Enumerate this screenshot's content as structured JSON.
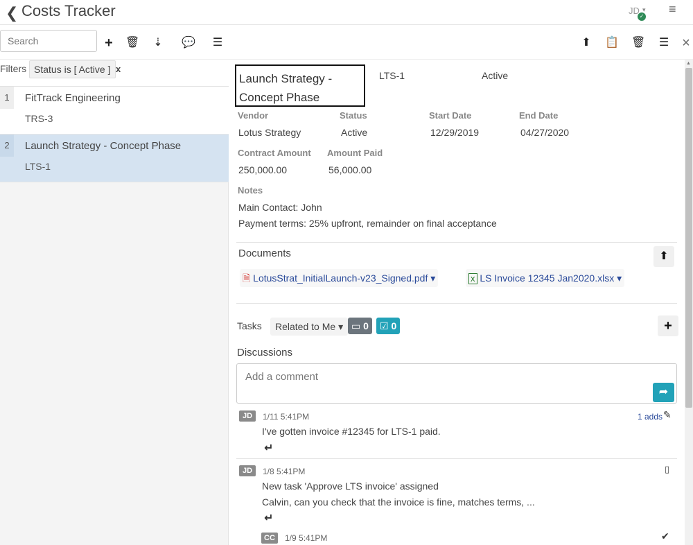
{
  "header": {
    "back_glyph": "❮",
    "title": "Costs Tracker",
    "user_initials": "JD",
    "caret": "▾",
    "presence_glyph": "✓",
    "menu_glyph": "≡"
  },
  "toolbar": {
    "search_placeholder": "Search",
    "add_glyph": "+",
    "delete_glyph": "🗑",
    "sort_glyph": "⇣",
    "comment_glyph": "💬",
    "menu_glyph": "☰",
    "export_glyph": "⬆",
    "attach_glyph": "📋",
    "delete2_glyph": "🗑",
    "menu2_glyph": "☰",
    "close_glyph": "×"
  },
  "filters": {
    "label": "Filters",
    "chip": "Status is [ Active ]",
    "remove": "x"
  },
  "list": [
    {
      "num": "1",
      "name": "FitTrack Engineering",
      "code": "TRS-3"
    },
    {
      "num": "2",
      "name": "Launch Strategy - Concept Phase",
      "code": "LTS-1"
    }
  ],
  "detail": {
    "title_line1": "Launch Strategy -",
    "title_line2": "Concept Phase",
    "code": "LTS-1",
    "status_top": "Active",
    "labels": {
      "vendor": "Vendor",
      "status": "Status",
      "start_date": "Start Date",
      "end_date": "End Date",
      "contract_amount": "Contract Amount",
      "amount_paid": "Amount Paid",
      "notes": "Notes"
    },
    "vendor": "Lotus Strategy",
    "status": "Active",
    "start_date": "12/29/2019",
    "end_date": "04/27/2020",
    "contract_amount": "250,000.00",
    "amount_paid": "56,000.00",
    "notes_line1": "Main Contact: John",
    "notes_line2": "Payment terms: 25% upfront, remainder on final acceptance"
  },
  "documents": {
    "heading": "Documents",
    "upload_glyph": "⬆",
    "files": [
      {
        "name": "LotusStrat_InitialLaunch-v23_Signed.pdf",
        "caret": "▾"
      },
      {
        "name": "LS Invoice 12345 Jan2020.xlsx",
        "caret": "▾"
      }
    ]
  },
  "tasks": {
    "heading": "Tasks",
    "filter": "Related to Me",
    "caret": "▾",
    "open_count": "0",
    "done_count": "0",
    "add_glyph": "+"
  },
  "discussions": {
    "heading": "Discussions",
    "placeholder": "Add a comment",
    "send_glyph": "➦",
    "comments": [
      {
        "initials": "JD",
        "time": "1/11 5:41PM",
        "text": "I've gotten invoice #12345 for LTS-1 paid.",
        "meta": "1 adds",
        "reply_glyph": "↵"
      },
      {
        "initials": "JD",
        "time": "1/8 5:41PM",
        "text1": "New task 'Approve LTS invoice' assigned",
        "text2": "Calvin, can you check that the invoice is fine, matches terms, ...",
        "reply_glyph": "↵"
      },
      {
        "initials": "CC",
        "time": "1/9 5:41PM",
        "check_glyph": "✔"
      }
    ]
  }
}
